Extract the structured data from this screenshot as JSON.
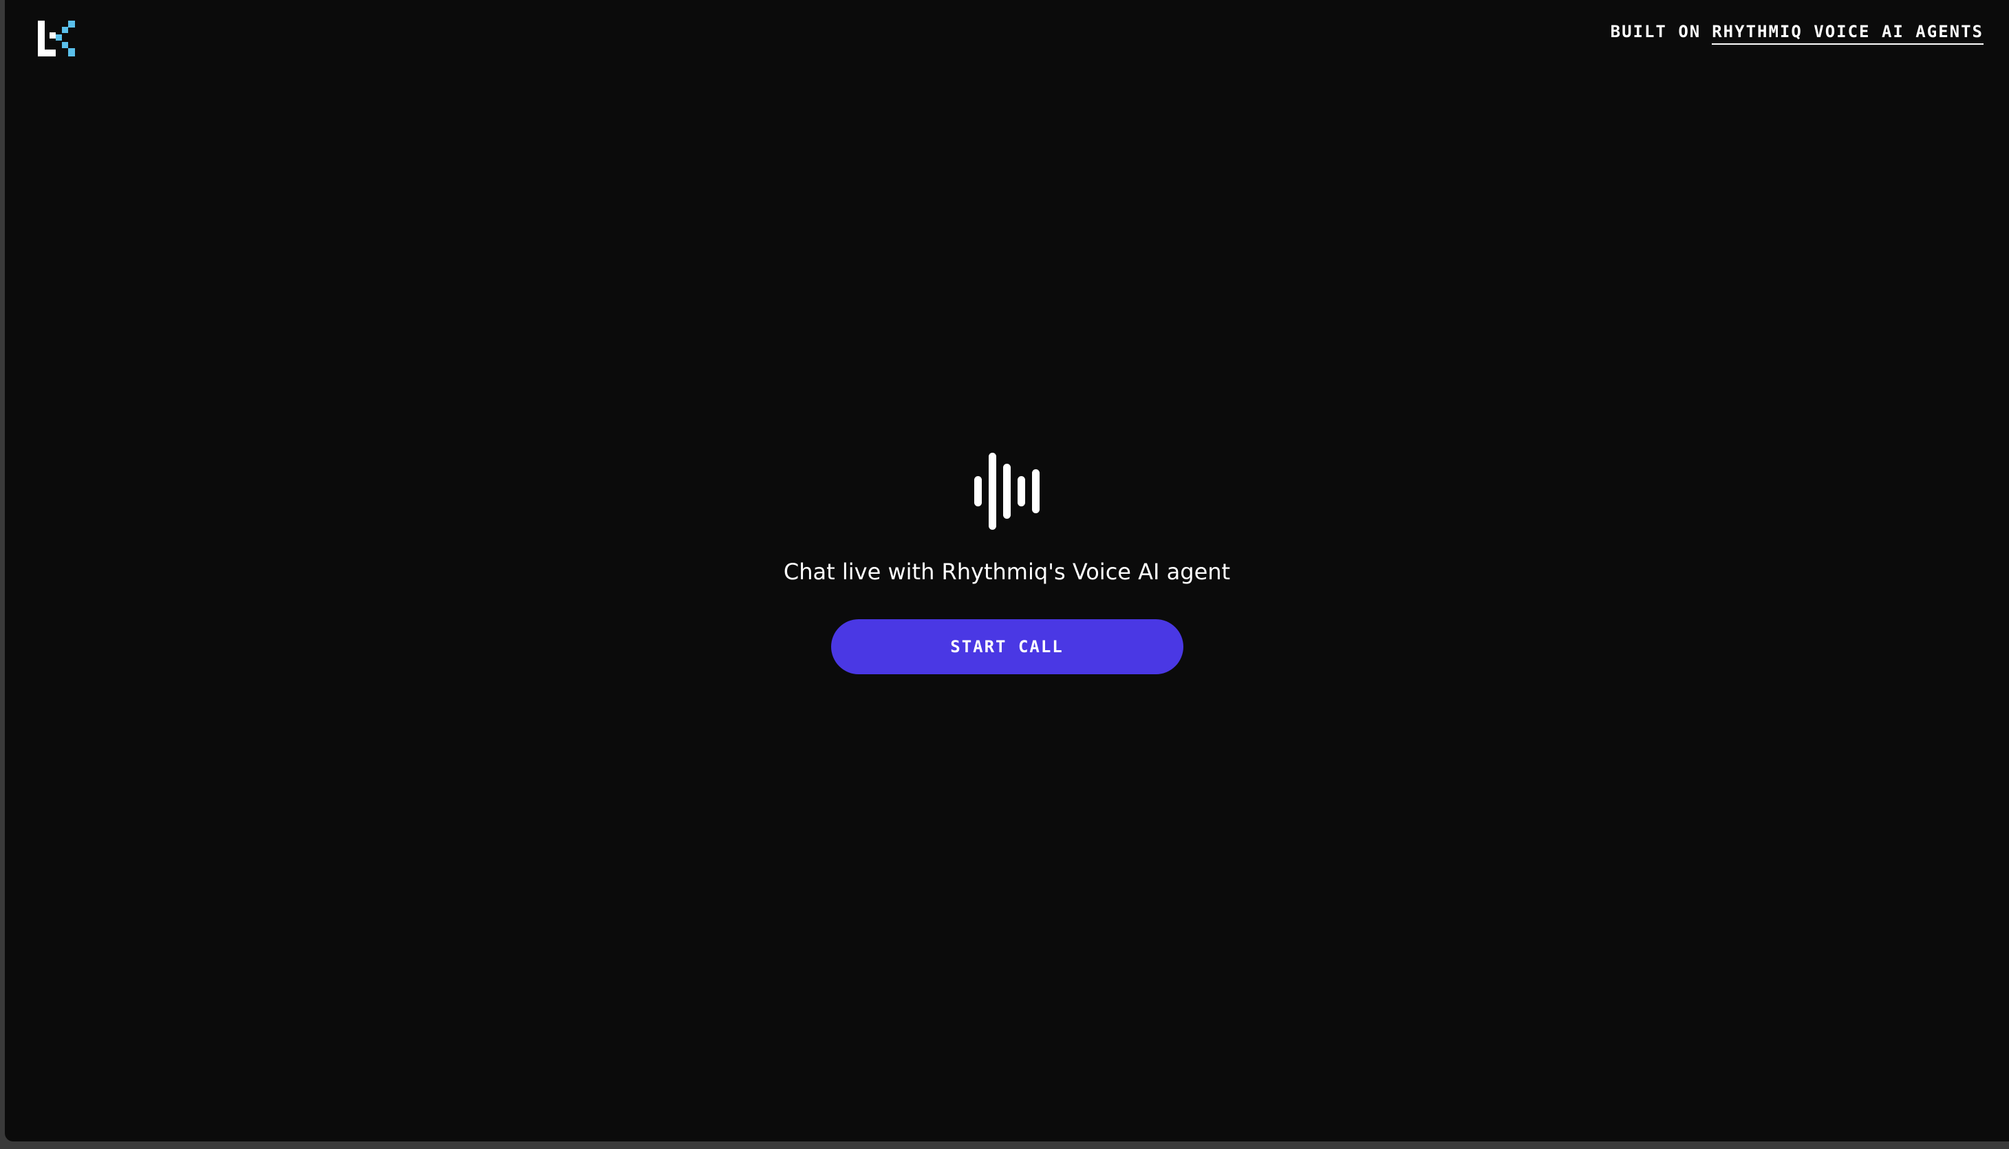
{
  "header": {
    "logo_icon": "lk-logo-icon",
    "built_on_prefix": "BUILT ON",
    "built_on_link": "RHYTHMIQ VOICE AI AGENTS"
  },
  "main": {
    "wave_icon": "audio-waveform-icon",
    "tagline": "Chat live with Rhythmiq's Voice AI agent",
    "start_call_label": "START CALL"
  },
  "colors": {
    "background": "#0b0b0b",
    "accent": "#4a38e4",
    "logo_accent": "#5bc0eb",
    "text": "#ffffff"
  }
}
